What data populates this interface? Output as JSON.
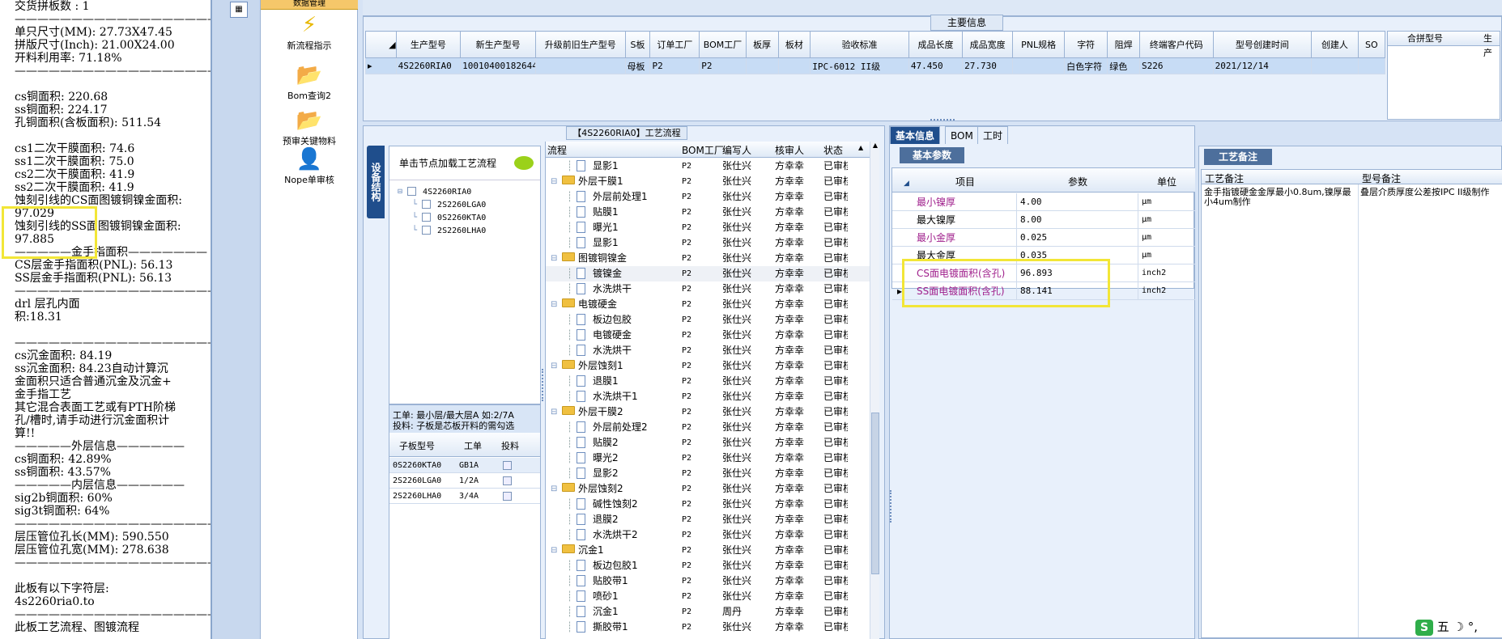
{
  "left_info": {
    "lines": [
      "交货拼板数 : 1",
      "———————————————————",
      "单只尺寸(MM): 27.73X47.45",
      "拼版尺寸(Inch): 21.00X24.00",
      "开料利用率: 71.18%",
      "———————————————————",
      "",
      "cs铜面积: 220.68",
      "ss铜面积: 224.17",
      "孔铜面积(含板面积): 511.54",
      "",
      "cs1二次干膜面积: 74.6",
      "ss1二次干膜面积: 75.0",
      "cs2二次干膜面积: 41.9",
      "ss2二次干膜面积: 41.9",
      "蚀刻引线的CS面图镀铜镍金面积:",
      "97.029",
      "蚀刻引线的SS面图镀铜镍金面积:",
      "97.885",
      "—————金手指面积———————",
      "CS层金手指面积(PNL): 56.13",
      "SS层金手指面积(PNL): 56.13",
      "———————————————————",
      "drl        层孔内面",
      "积:18.31",
      "",
      "———————————————————",
      "cs沉金面积: 84.19",
      "ss沉金面积: 84.23自动计算沉",
      "金面积只适合普通沉金及沉金+",
      "金手指工艺",
      "其它混合表面工艺或有PTH阶梯",
      "孔/槽时,请手动进行沉金面积计",
      "算!!",
      "—————外层信息——————",
      "cs铜面积: 42.89%",
      "ss铜面积: 43.57%",
      "—————内层信息——————",
      "sig2b铜面积: 60%",
      "sig3t铜面积: 64%",
      "———————————————————",
      "层压管位孔长(MM): 590.550",
      "层压管位孔宽(MM): 278.638",
      "———————————————————",
      "",
      "此板有以下字符层:",
      "4s2260ria0.to",
      "———————————————————",
      "此板工艺流程、图镀流程"
    ]
  },
  "nav": {
    "top_label": "数据管理",
    "items": [
      {
        "label": "新流程指示",
        "icon": "lightning-icon"
      },
      {
        "label": "Bom查询2",
        "icon": "folder-icon"
      },
      {
        "label": "预审关键物料",
        "icon": "folder-icon"
      },
      {
        "label": "Nope单审核",
        "icon": "user-icon"
      }
    ]
  },
  "main_info": {
    "group_title": "主要信息",
    "columns": [
      "生产型号",
      "新生产型号",
      "升级前旧生产型号",
      "S板",
      "订单工厂",
      "BOM工厂",
      "板厚",
      "板材",
      "验收标准",
      "成品长度",
      "成品宽度",
      "PNL规格",
      "字符",
      "阻焊",
      "终端客户代码",
      "型号创建时间",
      "创建人",
      "SO"
    ],
    "row": [
      "4S2260RIA0",
      "10010400182644",
      "",
      "母板",
      "P2",
      "P2",
      "",
      "",
      "IPC-6012 II级",
      "47.450",
      "27.730",
      "",
      "白色字符",
      "绿色",
      "S226",
      "2021/12/14",
      "",
      ""
    ],
    "side_columns": [
      "合拼型号",
      "生产"
    ]
  },
  "flow": {
    "panel_title": "【4S2260RIA0】工艺流程",
    "side_tab": "设备结构",
    "tree_hint": "单击节点加载工艺流程",
    "tree": [
      "4S2260RIA0",
      "2S2260LGA0",
      "0S2260KTA0",
      "2S2260LHA0"
    ],
    "sub_info_line1": "工单: 最小层/最大层A 如:2/7A",
    "sub_info_line2": "投料: 子板是芯板开料的需勾选",
    "sub_columns": [
      "子板型号",
      "工单",
      "投料"
    ],
    "sub_rows": [
      {
        "model": "0S2260KTA0",
        "order": "GB1A"
      },
      {
        "model": "2S2260LGA0",
        "order": "1/2A"
      },
      {
        "model": "2S2260LHA0",
        "order": "3/4A"
      }
    ],
    "list_columns": [
      "流程",
      "BOM工厂",
      "编写人",
      "核审人",
      "状态"
    ],
    "rows": [
      {
        "name": "显影1",
        "type": "doc",
        "lvl": 2,
        "factory": "P2",
        "writer": "张仕兴",
        "auditor": "方幸幸",
        "status": "已审核"
      },
      {
        "name": "外层干膜1",
        "type": "fold",
        "lvl": 1,
        "factory": "P2",
        "writer": "张仕兴",
        "auditor": "方幸幸",
        "status": "已审核"
      },
      {
        "name": "外层前处理1",
        "type": "doc",
        "lvl": 2,
        "factory": "P2",
        "writer": "张仕兴",
        "auditor": "方幸幸",
        "status": "已审核"
      },
      {
        "name": "贴膜1",
        "type": "doc",
        "lvl": 2,
        "factory": "P2",
        "writer": "张仕兴",
        "auditor": "方幸幸",
        "status": "已审核"
      },
      {
        "name": "曝光1",
        "type": "doc",
        "lvl": 2,
        "factory": "P2",
        "writer": "张仕兴",
        "auditor": "方幸幸",
        "status": "已审核"
      },
      {
        "name": "显影1",
        "type": "doc",
        "lvl": 2,
        "factory": "P2",
        "writer": "张仕兴",
        "auditor": "方幸幸",
        "status": "已审核"
      },
      {
        "name": "图镀铜镍金",
        "type": "fold",
        "lvl": 1,
        "factory": "P2",
        "writer": "张仕兴",
        "auditor": "方幸幸",
        "status": "已审核"
      },
      {
        "name": "镀镍金",
        "type": "doc",
        "lvl": 2,
        "factory": "P2",
        "writer": "张仕兴",
        "auditor": "方幸幸",
        "status": "已审核"
      },
      {
        "name": "水洗烘干",
        "type": "doc",
        "lvl": 2,
        "factory": "P2",
        "writer": "张仕兴",
        "auditor": "方幸幸",
        "status": "已审核"
      },
      {
        "name": "电镀硬金",
        "type": "fold",
        "lvl": 1,
        "factory": "P2",
        "writer": "张仕兴",
        "auditor": "方幸幸",
        "status": "已审核"
      },
      {
        "name": "板边包胶",
        "type": "doc",
        "lvl": 2,
        "factory": "P2",
        "writer": "张仕兴",
        "auditor": "方幸幸",
        "status": "已审核"
      },
      {
        "name": "电镀硬金",
        "type": "doc",
        "lvl": 2,
        "factory": "P2",
        "writer": "张仕兴",
        "auditor": "方幸幸",
        "status": "已审核"
      },
      {
        "name": "水洗烘干",
        "type": "doc",
        "lvl": 2,
        "factory": "P2",
        "writer": "张仕兴",
        "auditor": "方幸幸",
        "status": "已审核"
      },
      {
        "name": "外层蚀刻1",
        "type": "fold",
        "lvl": 1,
        "factory": "P2",
        "writer": "张仕兴",
        "auditor": "方幸幸",
        "status": "已审核"
      },
      {
        "name": "退膜1",
        "type": "doc",
        "lvl": 2,
        "factory": "P2",
        "writer": "张仕兴",
        "auditor": "方幸幸",
        "status": "已审核"
      },
      {
        "name": "水洗烘干1",
        "type": "doc",
        "lvl": 2,
        "factory": "P2",
        "writer": "张仕兴",
        "auditor": "方幸幸",
        "status": "已审核"
      },
      {
        "name": "外层干膜2",
        "type": "fold",
        "lvl": 1,
        "factory": "P2",
        "writer": "张仕兴",
        "auditor": "方幸幸",
        "status": "已审核"
      },
      {
        "name": "外层前处理2",
        "type": "doc",
        "lvl": 2,
        "factory": "P2",
        "writer": "张仕兴",
        "auditor": "方幸幸",
        "status": "已审核"
      },
      {
        "name": "贴膜2",
        "type": "doc",
        "lvl": 2,
        "factory": "P2",
        "writer": "张仕兴",
        "auditor": "方幸幸",
        "status": "已审核"
      },
      {
        "name": "曝光2",
        "type": "doc",
        "lvl": 2,
        "factory": "P2",
        "writer": "张仕兴",
        "auditor": "方幸幸",
        "status": "已审核"
      },
      {
        "name": "显影2",
        "type": "doc",
        "lvl": 2,
        "factory": "P2",
        "writer": "张仕兴",
        "auditor": "方幸幸",
        "status": "已审核"
      },
      {
        "name": "外层蚀刻2",
        "type": "fold",
        "lvl": 1,
        "factory": "P2",
        "writer": "张仕兴",
        "auditor": "方幸幸",
        "status": "已审核"
      },
      {
        "name": "碱性蚀刻2",
        "type": "doc",
        "lvl": 2,
        "factory": "P2",
        "writer": "张仕兴",
        "auditor": "方幸幸",
        "status": "已审核"
      },
      {
        "name": "退膜2",
        "type": "doc",
        "lvl": 2,
        "factory": "P2",
        "writer": "张仕兴",
        "auditor": "方幸幸",
        "status": "已审核"
      },
      {
        "name": "水洗烘干2",
        "type": "doc",
        "lvl": 2,
        "factory": "P2",
        "writer": "张仕兴",
        "auditor": "方幸幸",
        "status": "已审核"
      },
      {
        "name": "沉金1",
        "type": "fold",
        "lvl": 1,
        "factory": "P2",
        "writer": "张仕兴",
        "auditor": "方幸幸",
        "status": "已审核"
      },
      {
        "name": "板边包胶1",
        "type": "doc",
        "lvl": 2,
        "factory": "P2",
        "writer": "张仕兴",
        "auditor": "方幸幸",
        "status": "已审核"
      },
      {
        "name": "贴胶带1",
        "type": "doc",
        "lvl": 2,
        "factory": "P2",
        "writer": "张仕兴",
        "auditor": "方幸幸",
        "status": "已审核"
      },
      {
        "name": "喷砂1",
        "type": "doc",
        "lvl": 2,
        "factory": "P2",
        "writer": "张仕兴",
        "auditor": "方幸幸",
        "status": "已审核"
      },
      {
        "name": "沉金1",
        "type": "doc",
        "lvl": 2,
        "factory": "P2",
        "writer": "周丹",
        "auditor": "方幸幸",
        "status": "已审核"
      },
      {
        "name": "撕胶带1",
        "type": "doc",
        "lvl": 2,
        "factory": "P2",
        "writer": "张仕兴",
        "auditor": "方幸幸",
        "status": "已审核"
      }
    ]
  },
  "basic": {
    "tabs": [
      "基本信息",
      "BOM",
      "工时"
    ],
    "section": "基本参数",
    "columns": [
      "项目",
      "参数",
      "单位"
    ],
    "rows": [
      {
        "item": "最小镍厚",
        "value": "4.00",
        "unit": "μm",
        "color": "#a0208c"
      },
      {
        "item": "最大镍厚",
        "value": "8.00",
        "unit": "μm",
        "color": "#000000"
      },
      {
        "item": "最小金厚",
        "value": "0.025",
        "unit": "μm",
        "color": "#a0208c"
      },
      {
        "item": "最大金厚",
        "value": "0.035",
        "unit": "μm",
        "color": "#000000"
      },
      {
        "item": "CS面电镀面积(含孔)",
        "value": "96.893",
        "unit": "inch2",
        "color": "#a0208c"
      },
      {
        "item": "SS面电镀面积(含孔)",
        "value": "88.141",
        "unit": "inch2",
        "color": "#a0208c"
      }
    ]
  },
  "notes": {
    "section": "工艺备注",
    "columns": [
      "工艺备注",
      "型号备注"
    ],
    "process_note": "金手指镀硬金金厚最小0.8um,镍厚最小4um制作",
    "model_note": "叠层介质厚度公差按IPC II级制作"
  },
  "taskbar": {
    "ime": "五 ☽ °,"
  },
  "colors": {
    "highlight": "#f2e637",
    "accent": "#1f4e8c",
    "selected": "#c7dcf5"
  }
}
